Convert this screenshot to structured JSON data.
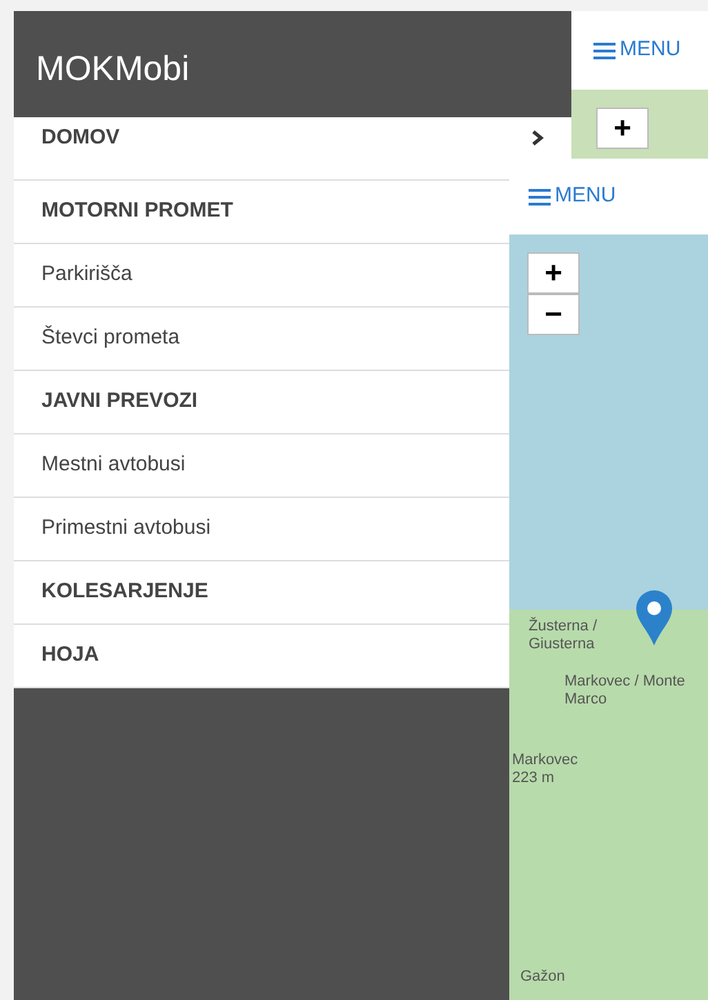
{
  "side_panel": {
    "title": "MOKMobi",
    "items": [
      {
        "label": "DOMOV",
        "kind": "section",
        "arrow": true
      },
      {
        "label": "MOTORNI PROMET",
        "kind": "section",
        "arrow": false
      },
      {
        "label": "Parkirišča",
        "kind": "link",
        "arrow": false
      },
      {
        "label": "Števci prometa",
        "kind": "link",
        "arrow": false
      },
      {
        "label": "JAVNI PREVOZI",
        "kind": "section",
        "arrow": false
      },
      {
        "label": "Mestni avtobusi",
        "kind": "link",
        "arrow": false
      },
      {
        "label": "Primestni avtobusi",
        "kind": "link",
        "arrow": false
      },
      {
        "label": "KOLESARJENJE",
        "kind": "section",
        "arrow": false
      },
      {
        "label": "HOJA",
        "kind": "section",
        "arrow": false
      }
    ]
  },
  "back_screen": {
    "menu_button": "MENU",
    "zoom_in": "+"
  },
  "front_screen": {
    "menu_button": "MENU",
    "zoom_in": "+",
    "zoom_out": "−",
    "map_labels": [
      {
        "text": "Žusterna / Giusterna"
      },
      {
        "text": "Markovec / Monte Marco"
      },
      {
        "text": "Markovec 223 m"
      },
      {
        "text": "Gažon"
      }
    ]
  }
}
